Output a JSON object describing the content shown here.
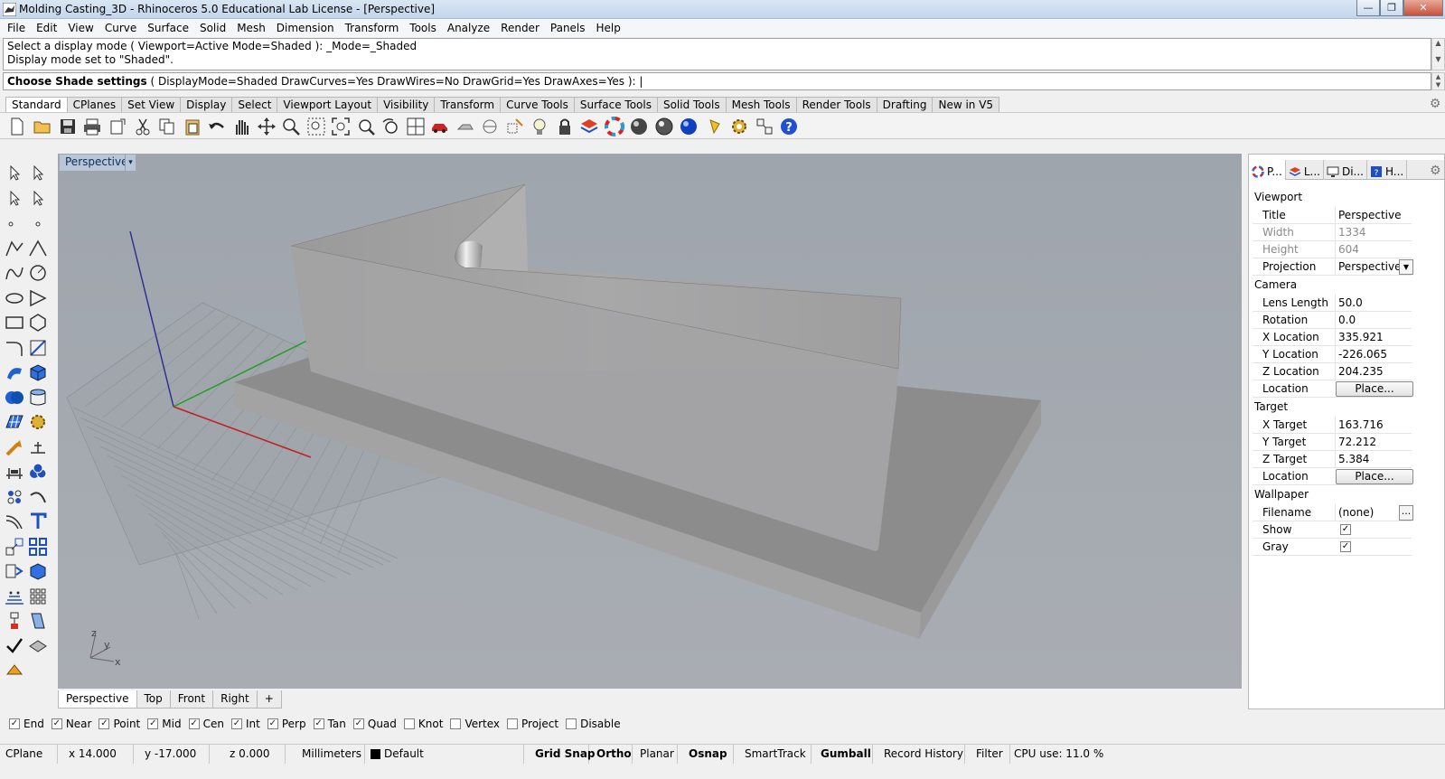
{
  "window": {
    "title": "Molding Casting_3D - Rhinoceros 5.0 Educational Lab License - [Perspective]",
    "minimize": "—",
    "restore": "❐",
    "close": "✕"
  },
  "menu": [
    "File",
    "Edit",
    "View",
    "Curve",
    "Surface",
    "Solid",
    "Mesh",
    "Dimension",
    "Transform",
    "Tools",
    "Analyze",
    "Render",
    "Panels",
    "Help"
  ],
  "command": {
    "history": [
      "Select a display mode ( Viewport=Active  Mode=Shaded ): _Mode=_Shaded",
      "Display mode set to \"Shaded\"."
    ],
    "prompt_bold": "Choose Shade settings",
    "prompt_rest": " ( DisplayMode=Shaded  DrawCurves=Yes  DrawWires=No  DrawGrid=Yes  DrawAxes=Yes ): |"
  },
  "toolbar_tabs": [
    "Standard",
    "CPlanes",
    "Set View",
    "Display",
    "Select",
    "Viewport Layout",
    "Visibility",
    "Transform",
    "Curve Tools",
    "Surface Tools",
    "Solid Tools",
    "Mesh Tools",
    "Render Tools",
    "Drafting",
    "New in V5"
  ],
  "toolbar_icons": [
    "new-file-icon",
    "open-folder-icon",
    "save-icon",
    "print-icon",
    "copy-to-clipboard-icon",
    "cut-icon",
    "copy-icon",
    "paste-icon",
    "undo-icon",
    "pan-icon",
    "rotate-view-icon",
    "zoom-icon",
    "zoom-window-icon",
    "zoom-extents-icon",
    "zoom-selected-icon",
    "undo-view-icon",
    "four-viewports-icon",
    "car-icon",
    "hide-icon",
    "show-icon",
    "snap-icon",
    "light-bulb-icon",
    "lock-icon",
    "layer-icon",
    "color-wheel-icon",
    "shaded-sphere-icon",
    "rendered-sphere-icon",
    "render-sphere-icon",
    "render-lamp-icon",
    "options-gear-icon",
    "box-edit-icon",
    "help-icon"
  ],
  "colors": {
    "viewport_bg": "#a4a9b0",
    "model_top": "#8f8f90",
    "model_side": "#a9a9aa",
    "axis_x": "#c02020",
    "axis_y": "#20a020",
    "axis_z": "#303090"
  },
  "viewport": {
    "title": "Perspective",
    "dropdown": "▾",
    "axis_labels": {
      "z": "z",
      "y": "y",
      "x": "x"
    }
  },
  "viewport_tabs": [
    "Perspective",
    "Top",
    "Front",
    "Right",
    "+"
  ],
  "osnaps": [
    {
      "label": "End",
      "checked": true
    },
    {
      "label": "Near",
      "checked": true
    },
    {
      "label": "Point",
      "checked": true
    },
    {
      "label": "Mid",
      "checked": true
    },
    {
      "label": "Cen",
      "checked": true
    },
    {
      "label": "Int",
      "checked": true
    },
    {
      "label": "Perp",
      "checked": true
    },
    {
      "label": "Tan",
      "checked": true
    },
    {
      "label": "Quad",
      "checked": true
    },
    {
      "label": "Knot",
      "checked": false
    },
    {
      "label": "Vertex",
      "checked": false
    },
    {
      "label": "Project",
      "checked": false
    },
    {
      "label": "Disable",
      "checked": false
    }
  ],
  "status": {
    "cplane": "CPlane",
    "x": "x 14.000",
    "y": "y -17.000",
    "z": "z 0.000",
    "units": "Millimeters",
    "layer": "Default",
    "grid_snap": "Grid Snap",
    "ortho": "Ortho",
    "planar": "Planar",
    "osnap": "Osnap",
    "smarttrack": "SmartTrack",
    "gumball": "Gumball",
    "record_history": "Record History",
    "filter": "Filter",
    "cpu": "CPU use: 11.0 %"
  },
  "panel": {
    "tabs": [
      "P...",
      "L...",
      "Di...",
      "H..."
    ],
    "viewport_section": "Viewport",
    "camera_section": "Camera",
    "target_section": "Target",
    "wallpaper_section": "Wallpaper",
    "viewport_rows": [
      {
        "label": "Title",
        "value": "Perspective"
      },
      {
        "label": "Width",
        "value": "1334"
      },
      {
        "label": "Height",
        "value": "604"
      },
      {
        "label": "Projection",
        "value": "Perspective"
      }
    ],
    "camera_rows": [
      {
        "label": "Lens Length",
        "value": "50.0"
      },
      {
        "label": "Rotation",
        "value": "0.0"
      },
      {
        "label": "X Location",
        "value": "335.921"
      },
      {
        "label": "Y Location",
        "value": "-226.065"
      },
      {
        "label": "Z Location",
        "value": "204.235"
      },
      {
        "label": "Location",
        "value": "Place..."
      }
    ],
    "target_rows": [
      {
        "label": "X Target",
        "value": "163.716"
      },
      {
        "label": "Y Target",
        "value": "72.212"
      },
      {
        "label": "Z Target",
        "value": "5.384"
      },
      {
        "label": "Location",
        "value": "Place..."
      }
    ],
    "wallpaper_rows": [
      {
        "label": "Filename",
        "value": "(none)"
      },
      {
        "label": "Show",
        "checked": true
      },
      {
        "label": "Gray",
        "checked": true
      }
    ],
    "dropdown_arrow": "▼",
    "browse": "..."
  }
}
